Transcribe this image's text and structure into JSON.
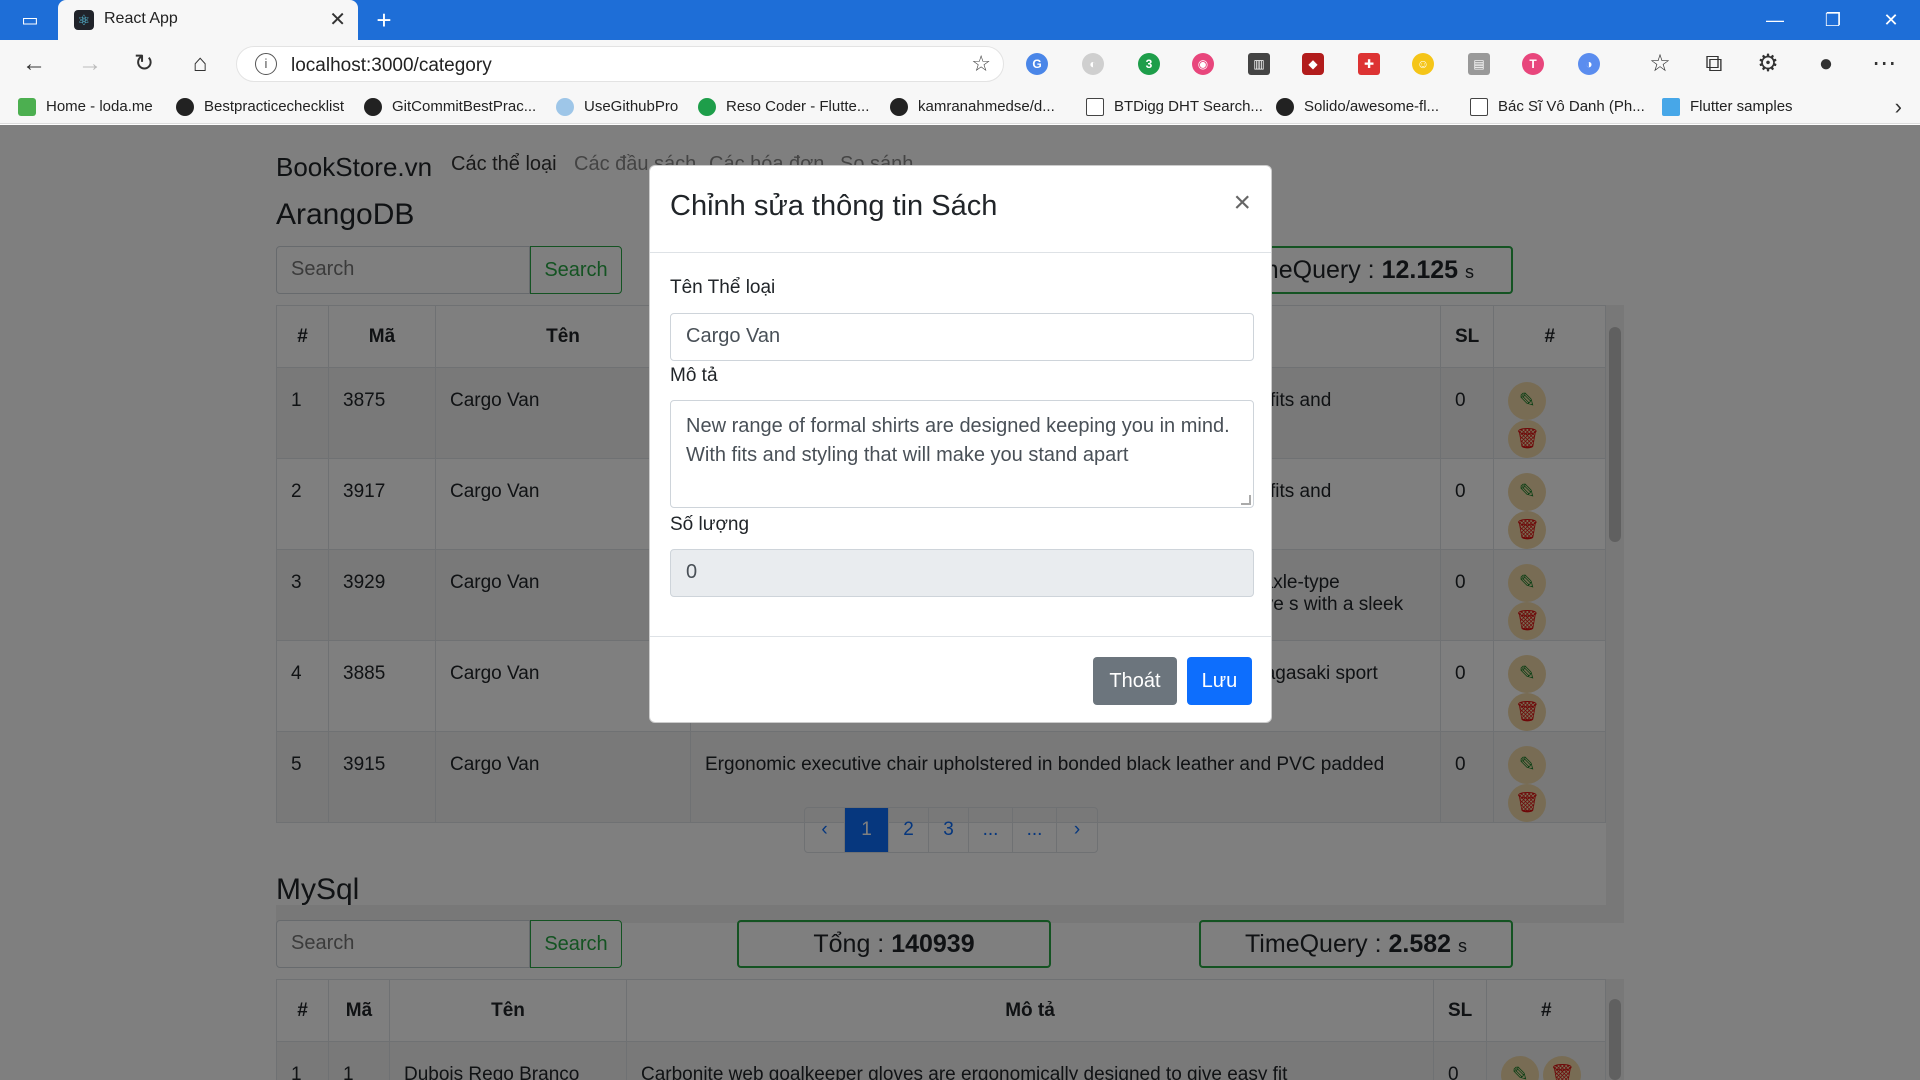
{
  "browser": {
    "tab_title": "React App",
    "url": "localhost:3000/category",
    "bookmarks": [
      "Home - loda.me",
      "Bestpracticechecklist",
      "GitCommitBestPrac...",
      "UseGithubPro",
      "Reso Coder - Flutte...",
      "kamranahmedse/d...",
      "BTDigg DHT Search...",
      "Solido/awesome-fl...",
      "Bác Sĩ Vô Danh (Ph...",
      "Flutter samples"
    ],
    "extension_badge": "3"
  },
  "nav": {
    "brand": "BookStore.vn",
    "links": [
      "Các thể loại",
      "Các đầu sách",
      "Các hóa đơn",
      "So sánh"
    ]
  },
  "arango": {
    "title": "ArangoDB",
    "search_placeholder": "Search",
    "search_button": "Search",
    "time_label": "TimeQuery : ",
    "time_value": "12.125",
    "time_unit": "s",
    "columns": [
      "#",
      "Mã",
      "Tên",
      "Mô tả",
      "SL",
      "#"
    ],
    "rows": [
      {
        "idx": "1",
        "code": "3875",
        "name": "Cargo Van",
        "desc": "New range of formal shirts are designed keeping you in mind. With fits and",
        "qty": "0"
      },
      {
        "idx": "2",
        "code": "3917",
        "name": "Cargo Van",
        "desc": "New range of formal shirts are designed keeping you in mind. With fits and",
        "qty": "0"
      },
      {
        "idx": "3",
        "code": "3929",
        "name": "Cargo Van",
        "desc": "The automobile layout consists of a front-engine design, with transaxle-type transmissions mounted at the rear of the engine and four wheel drive s with a sleek",
        "qty": "0"
      },
      {
        "idx": "4",
        "code": "3885",
        "name": "Cargo Van",
        "desc": "The Football Is Good For Training And Recreational Purposes of Nagasaki sport",
        "qty": "0"
      },
      {
        "idx": "5",
        "code": "3915",
        "name": "Cargo Van",
        "desc": "Ergonomic executive chair upholstered in bonded black leather and PVC padded",
        "qty": "0"
      }
    ],
    "pagination": [
      "‹",
      "1",
      "2",
      "3",
      "...",
      "...",
      "›"
    ]
  },
  "mysql": {
    "title": "MySql",
    "search_placeholder": "Search",
    "search_button": "Search",
    "total_label": "Tổng : ",
    "total_value": "140939",
    "time_label": "TimeQuery : ",
    "time_value": "2.582",
    "time_unit": "s",
    "columns": [
      "#",
      "Mã",
      "Tên",
      "Mô tả",
      "SL",
      "#"
    ],
    "rows": [
      {
        "idx": "1",
        "code": "1",
        "name": "Dubois Rego Branco",
        "desc": "Carbonite web goalkeeper gloves are ergonomically designed to give easy fit",
        "qty": "0"
      }
    ]
  },
  "modal": {
    "title": "Chỉnh sửa thông tin Sách",
    "close": "×",
    "name_label": "Tên Thể loại",
    "name_value": "Cargo Van",
    "desc_label": "Mô tả",
    "desc_value": "New range of formal shirts are designed keeping you in mind. With fits and styling that will make you stand apart",
    "qty_label": "Số lượng",
    "qty_value": "0",
    "cancel": "Thoát",
    "save": "Lưu"
  },
  "colors": {
    "titlebar": "#1e6ed7",
    "success": "#28a745",
    "primary": "#0d6efd",
    "secondary": "#6c757d"
  }
}
